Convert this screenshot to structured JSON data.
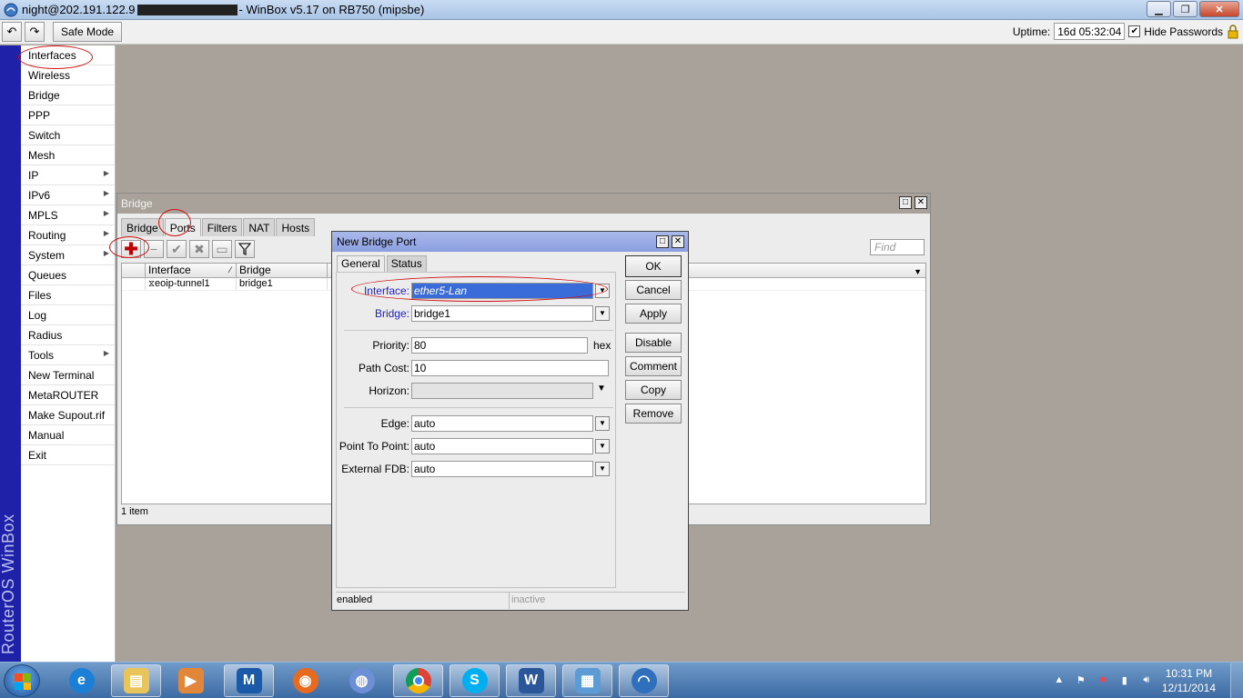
{
  "window": {
    "title_prefix": "night@202.191.122.9",
    "title_suffix": " - WinBox v5.17 on RB750 (mipsbe)"
  },
  "toolbar": {
    "undo_label": "↶",
    "redo_label": "↷",
    "safe_mode_label": "Safe Mode",
    "uptime_label": "Uptime:",
    "uptime_value": "16d 05:32:04",
    "hide_passwords_label": "Hide Passwords",
    "hide_passwords_checked": true
  },
  "brand": "RouterOS WinBox",
  "sidebar": {
    "items": [
      {
        "label": "Interfaces",
        "submenu": false
      },
      {
        "label": "Wireless",
        "submenu": false
      },
      {
        "label": "Bridge",
        "submenu": false
      },
      {
        "label": "PPP",
        "submenu": false
      },
      {
        "label": "Switch",
        "submenu": false
      },
      {
        "label": "Mesh",
        "submenu": false
      },
      {
        "label": "IP",
        "submenu": true
      },
      {
        "label": "IPv6",
        "submenu": true
      },
      {
        "label": "MPLS",
        "submenu": true
      },
      {
        "label": "Routing",
        "submenu": true
      },
      {
        "label": "System",
        "submenu": true
      },
      {
        "label": "Queues",
        "submenu": false
      },
      {
        "label": "Files",
        "submenu": false
      },
      {
        "label": "Log",
        "submenu": false
      },
      {
        "label": "Radius",
        "submenu": false
      },
      {
        "label": "Tools",
        "submenu": true
      },
      {
        "label": "New Terminal",
        "submenu": false
      },
      {
        "label": "MetaROUTER",
        "submenu": false
      },
      {
        "label": "Make Supout.rif",
        "submenu": false
      },
      {
        "label": "Manual",
        "submenu": false
      },
      {
        "label": "Exit",
        "submenu": false
      }
    ]
  },
  "bridge_window": {
    "title": "Bridge",
    "tabs": [
      "Bridge",
      "Ports",
      "Filters",
      "NAT",
      "Hosts"
    ],
    "active_tab": "Ports",
    "find_placeholder": "Find",
    "columns": [
      "Interface",
      "Bridge"
    ],
    "rows": [
      {
        "interface": "eoip-tunnel1",
        "bridge": "bridge1"
      }
    ],
    "status": "1 item"
  },
  "dialog": {
    "title": "New Bridge Port",
    "tabs": [
      "General",
      "Status"
    ],
    "active_tab": "General",
    "fields": {
      "interface": {
        "label": "Interface:",
        "value": "ether5-Lan"
      },
      "bridge": {
        "label": "Bridge:",
        "value": "bridge1"
      },
      "priority": {
        "label": "Priority:",
        "value": "80",
        "unit": "hex"
      },
      "path_cost": {
        "label": "Path Cost:",
        "value": "10"
      },
      "horizon": {
        "label": "Horizon:",
        "value": ""
      },
      "edge": {
        "label": "Edge:",
        "value": "auto"
      },
      "point_to_point": {
        "label": "Point To Point:",
        "value": "auto"
      },
      "external_fdb": {
        "label": "External FDB:",
        "value": "auto"
      }
    },
    "buttons": [
      "OK",
      "Cancel",
      "Apply",
      "Disable",
      "Comment",
      "Copy",
      "Remove"
    ],
    "status_left": "enabled",
    "status_right": "inactive"
  },
  "taskbar": {
    "clock_time": "10:31 PM",
    "clock_date": "12/11/2014"
  },
  "colors": {
    "brand_strip": "#1f22a8",
    "desktop": "#a9a29a",
    "dialog_title": "#8b9ee0",
    "selection": "#3a6cd9",
    "annotation": "#d01010"
  }
}
